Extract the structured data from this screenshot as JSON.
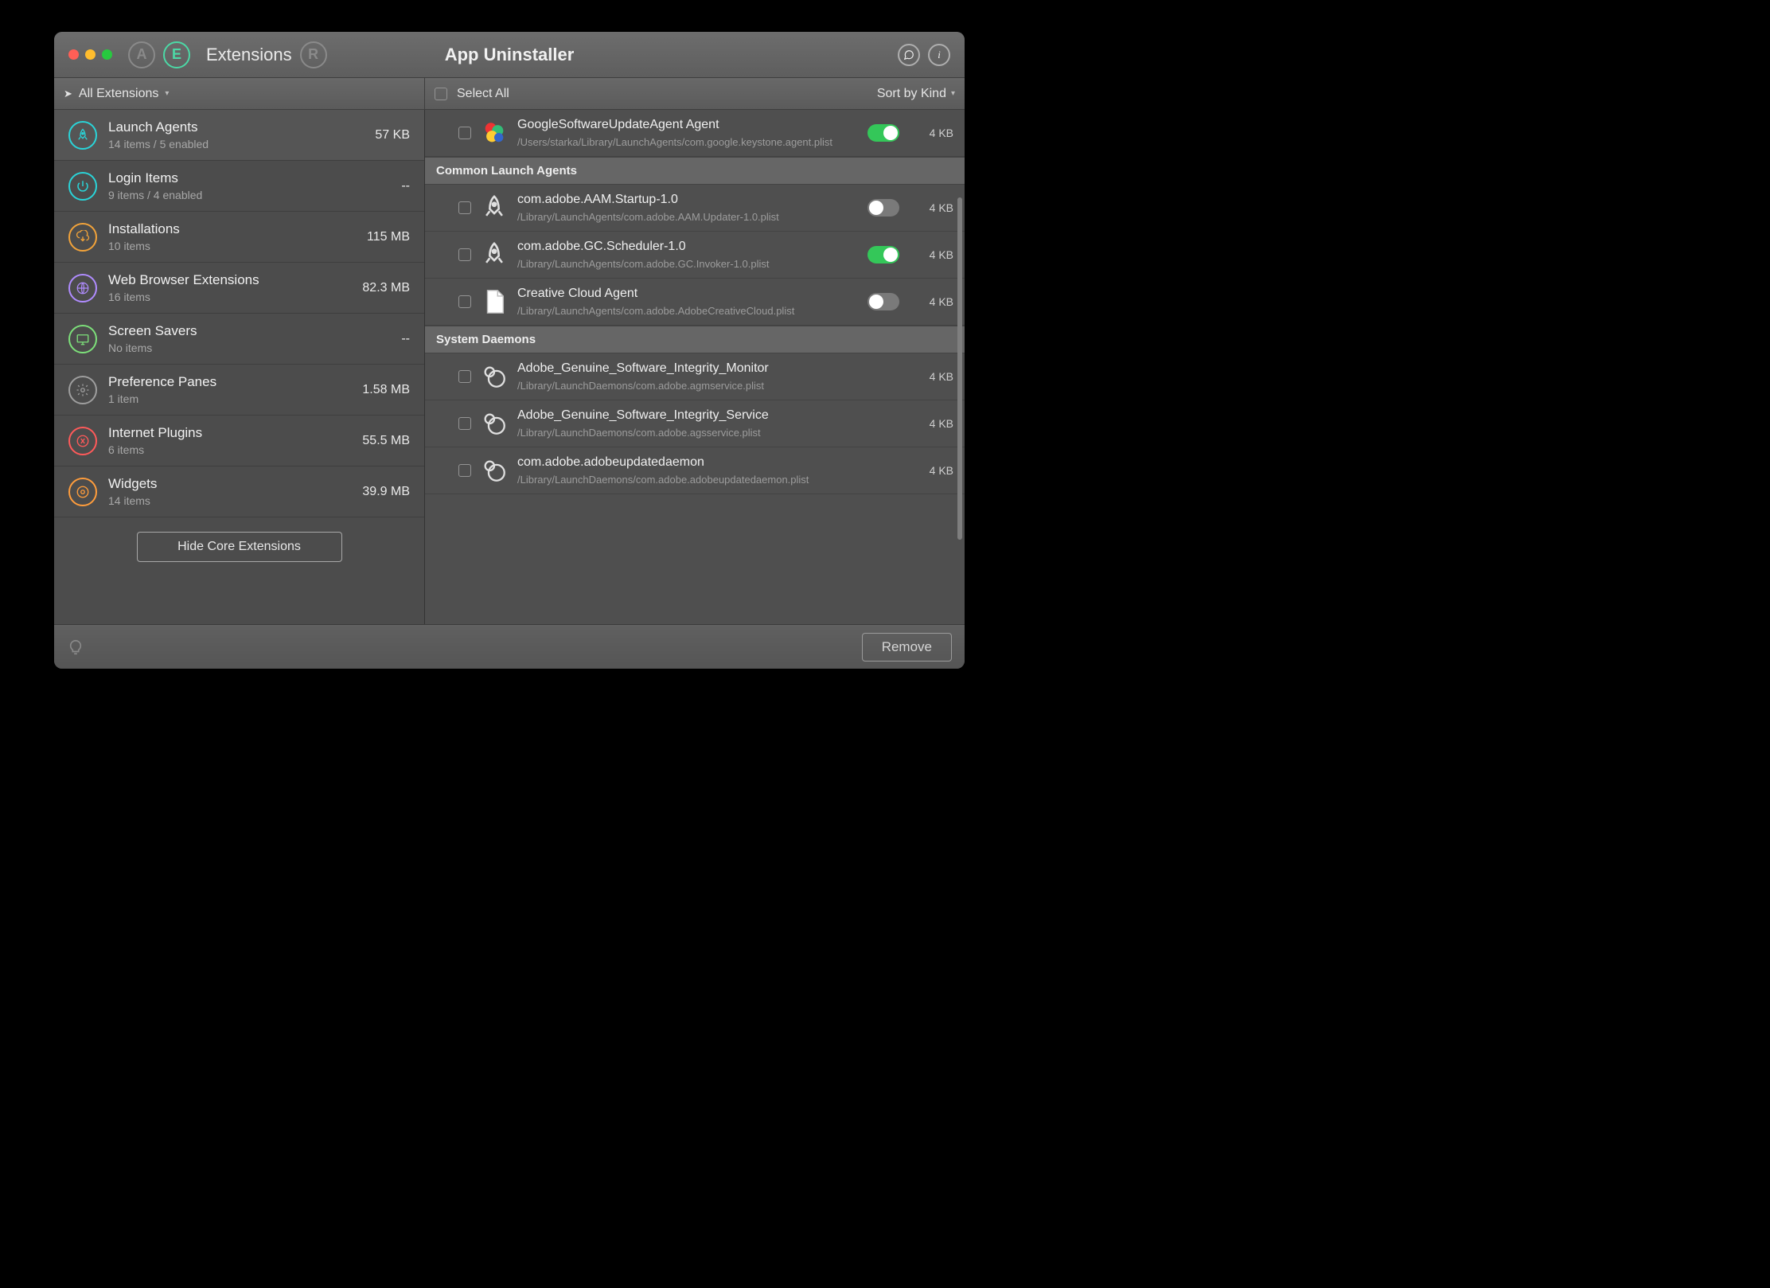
{
  "window": {
    "app_title": "App Uninstaller",
    "section_title": "Extensions"
  },
  "titlebar_right": {
    "feedback": "feedback",
    "info": "info"
  },
  "toolbar": {
    "filter_label": "All Extensions",
    "select_all_label": "Select All",
    "sort_label": "Sort by Kind"
  },
  "sidebar": {
    "hide_button": "Hide Core Extensions",
    "categories": [
      {
        "title": "Launch Agents",
        "sub": "14 items / 5 enabled",
        "size": "57 KB",
        "color": "#2ad4d8",
        "icon": "rocket",
        "active": true
      },
      {
        "title": "Login Items",
        "sub": "9 items / 4 enabled",
        "size": "--",
        "color": "#2ad4d8",
        "icon": "power",
        "active": false
      },
      {
        "title": "Installations",
        "sub": "10 items",
        "size": "115 MB",
        "color": "#f2a33a",
        "icon": "download",
        "active": false
      },
      {
        "title": "Web Browser Extensions",
        "sub": "16 items",
        "size": "82.3 MB",
        "color": "#b08cff",
        "icon": "globe",
        "active": false
      },
      {
        "title": "Screen Savers",
        "sub": "No items",
        "size": "--",
        "color": "#7de07a",
        "icon": "screen",
        "active": false
      },
      {
        "title": "Preference Panes",
        "sub": "1 item",
        "size": "1.58 MB",
        "color": "#9e9e9e",
        "icon": "gear",
        "active": false
      },
      {
        "title": "Internet Plugins",
        "sub": "6 items",
        "size": "55.5 MB",
        "color": "#ff5a5a",
        "icon": "plug",
        "active": false
      },
      {
        "title": "Widgets",
        "sub": "14 items",
        "size": "39.9 MB",
        "color": "#ff9d3c",
        "icon": "widget",
        "active": false
      }
    ]
  },
  "main": {
    "top_item": {
      "name": "GoogleSoftwareUpdateAgent Agent",
      "path": "/Users/starka/Library/LaunchAgents/com.google.keystone.agent.plist",
      "size": "4 KB",
      "toggle": true,
      "icon": "balls"
    },
    "groups": [
      {
        "header": "Common Launch Agents",
        "items": [
          {
            "name": "com.adobe.AAM.Startup-1.0",
            "path": "/Library/LaunchAgents/com.adobe.AAM.Updater-1.0.plist",
            "size": "4 KB",
            "toggle": false,
            "icon": "rocket"
          },
          {
            "name": "com.adobe.GC.Scheduler-1.0",
            "path": "/Library/LaunchAgents/com.adobe.GC.Invoker-1.0.plist",
            "size": "4 KB",
            "toggle": true,
            "icon": "rocket"
          },
          {
            "name": "Creative Cloud Agent",
            "path": "/Library/LaunchAgents/com.adobe.AdobeCreativeCloud.plist",
            "size": "4 KB",
            "toggle": false,
            "icon": "doc"
          }
        ]
      },
      {
        "header": "System Daemons",
        "items": [
          {
            "name": "Adobe_Genuine_Software_Integrity_Monitor",
            "path": "/Library/LaunchDaemons/com.adobe.agmservice.plist",
            "size": "4 KB",
            "toggle": null,
            "icon": "daemon"
          },
          {
            "name": "Adobe_Genuine_Software_Integrity_Service",
            "path": "/Library/LaunchDaemons/com.adobe.agsservice.plist",
            "size": "4 KB",
            "toggle": null,
            "icon": "daemon"
          },
          {
            "name": "com.adobe.adobeupdatedaemon",
            "path": "/Library/LaunchDaemons/com.adobe.adobeupdatedaemon.plist",
            "size": "4 KB",
            "toggle": null,
            "icon": "daemon"
          }
        ]
      }
    ]
  },
  "footer": {
    "remove_label": "Remove"
  },
  "colors": {
    "accent_green": "#34c759",
    "teal": "#4cd9a6"
  }
}
